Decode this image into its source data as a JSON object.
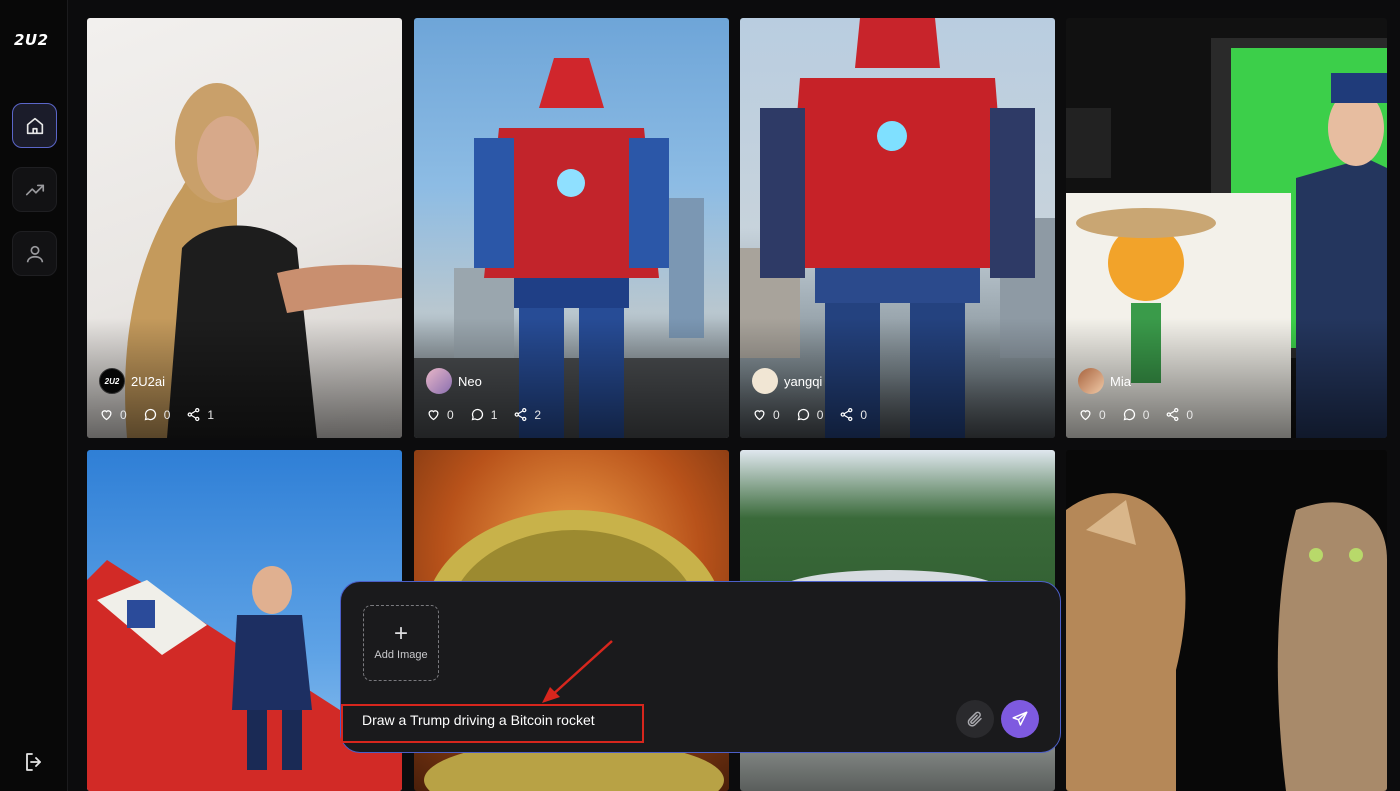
{
  "app": {
    "logo_text": "2U2"
  },
  "sidebar": {
    "items": [
      {
        "name": "home",
        "icon": "home-icon",
        "active": true
      },
      {
        "name": "trending",
        "icon": "trending-icon",
        "active": false
      },
      {
        "name": "profile",
        "icon": "user-icon",
        "active": false
      }
    ],
    "logout_icon": "logout-icon"
  },
  "feed": {
    "cards": [
      {
        "author": "2U2ai",
        "likes": "0",
        "comments": "0",
        "shares": "1"
      },
      {
        "author": "Neo",
        "likes": "0",
        "comments": "1",
        "shares": "2"
      },
      {
        "author": "yangqi",
        "likes": "0",
        "comments": "0",
        "shares": "0"
      },
      {
        "author": "Mia",
        "likes": "0",
        "comments": "0",
        "shares": "0"
      }
    ]
  },
  "prompt": {
    "add_image_label": "Add Image",
    "text": "Draw a Trump driving a Bitcoin rocket",
    "attach_icon": "paperclip-icon",
    "send_icon": "send-icon"
  },
  "colors": {
    "accent": "#7e5ae0",
    "border_active": "#4c5fc8",
    "annotation": "#d7261d"
  }
}
